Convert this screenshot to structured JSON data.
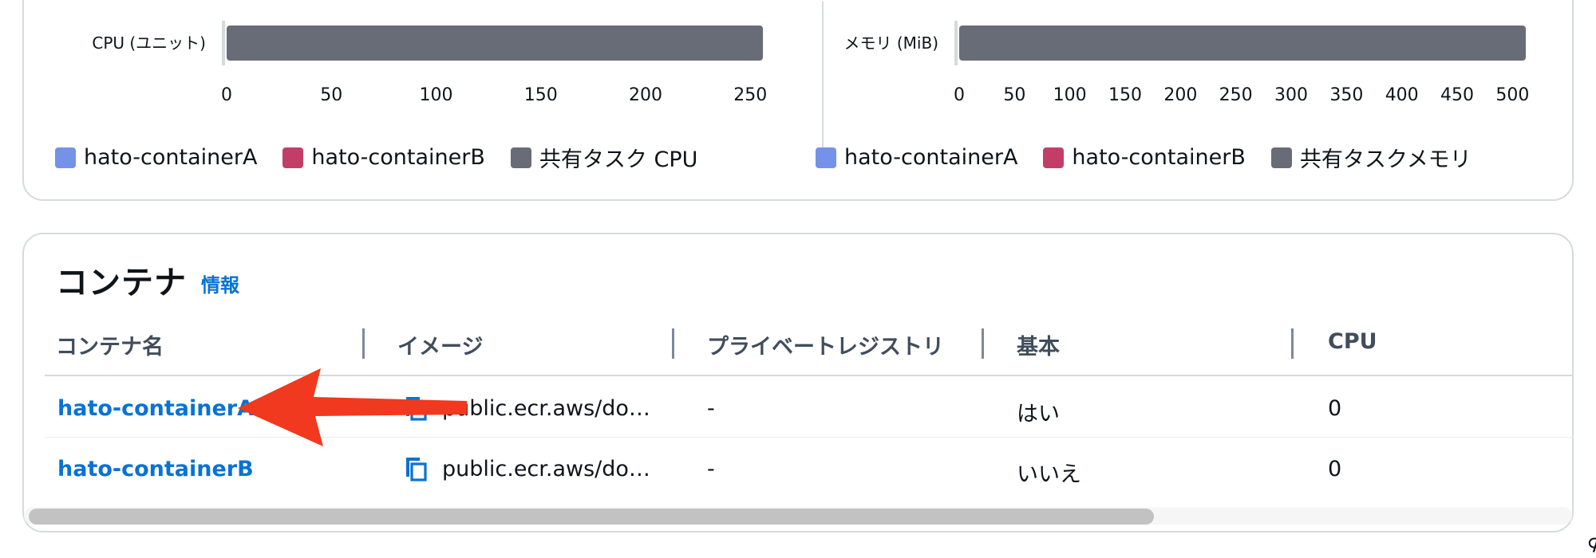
{
  "chart_data": [
    {
      "type": "bar",
      "orientation": "horizontal",
      "categories": [
        "CPU (ユニット)"
      ],
      "series": [
        {
          "name": "共有タスク CPU",
          "values": [
            256
          ],
          "color": "#686c76"
        }
      ],
      "x_ticks": [
        "0",
        "50",
        "100",
        "150",
        "200",
        "250"
      ],
      "xlim": [
        0,
        256
      ],
      "legend": [
        {
          "label": "hato-containerA",
          "color": "#7492e8"
        },
        {
          "label": "hato-containerB",
          "color": "#c33d69"
        },
        {
          "label": "共有タスク CPU",
          "color": "#686c76"
        }
      ],
      "legend_position": "bottom-left",
      "grid": false
    },
    {
      "type": "bar",
      "orientation": "horizontal",
      "categories": [
        "メモリ (MiB)"
      ],
      "series": [
        {
          "name": "共有タスクメモリ",
          "values": [
            512
          ],
          "color": "#686c76"
        }
      ],
      "x_ticks": [
        "0",
        "50",
        "100",
        "150",
        "200",
        "250",
        "300",
        "350",
        "400",
        "450",
        "500"
      ],
      "xlim": [
        0,
        512
      ],
      "legend": [
        {
          "label": "hato-containerA",
          "color": "#7492e8"
        },
        {
          "label": "hato-containerB",
          "color": "#c33d69"
        },
        {
          "label": "共有タスクメモリ",
          "color": "#686c76"
        }
      ],
      "legend_position": "bottom-left",
      "grid": false
    }
  ],
  "containers_section": {
    "title": "コンテナ",
    "info_link": "情報",
    "columns": [
      "コンテナ名",
      "イメージ",
      "プライベートレジストリ",
      "基本",
      "CPU"
    ],
    "rows": [
      {
        "name": "hato-containerA",
        "image": "public.ecr.aws/do…",
        "private_registry": "-",
        "essential": "はい",
        "cpu": "0"
      },
      {
        "name": "hato-containerB",
        "image": "public.ecr.aws/do…",
        "private_registry": "-",
        "essential": "いいえ",
        "cpu": "0"
      }
    ],
    "image_icon": "copy-icon"
  },
  "annotation": {
    "arrow_color": "#f0391e",
    "arrow_target": "hato-containerA"
  },
  "corner_glyph": "⊄"
}
